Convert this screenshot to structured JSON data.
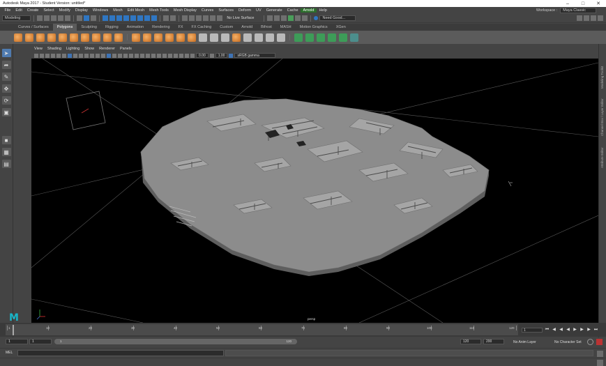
{
  "window": {
    "title": "Autodesk Maya 2017 - Student Version: untitled*"
  },
  "menubar": {
    "items": [
      "File",
      "Edit",
      "Create",
      "Select",
      "Modify",
      "Display",
      "Windows",
      "Mesh",
      "Edit Mesh",
      "Mesh Tools",
      "Mesh Display",
      "Curves",
      "Surfaces",
      "Deform",
      "UV",
      "Generate",
      "Cache",
      "Arnold",
      "Help"
    ],
    "highlighted": "Arnold",
    "workspace_label": "Workspace :",
    "workspace_value": "Maya Classic"
  },
  "statusline": {
    "mode": "Modeling",
    "live_surface": "No Live Surface",
    "user": "Need Good..."
  },
  "shelf": {
    "tabs": [
      "Curves / Surfaces",
      "Polygons",
      "Sculpting",
      "Rigging",
      "Animation",
      "Rendering",
      "FX",
      "FX Caching",
      "Custom",
      "Arnold",
      "Bifrost",
      "MASH",
      "Motion Graphics",
      "XGen"
    ],
    "active_tab": "Polygons"
  },
  "panel": {
    "menu": [
      "View",
      "Shading",
      "Lighting",
      "Show",
      "Renderer",
      "Panels"
    ],
    "exposure": "0.00",
    "gamma": "1.00",
    "color_space": "sRGB gamma",
    "camera": "persp"
  },
  "right_strip": {
    "labels": [
      "Modeling Toolkit",
      "Channel Box / Layer Editor",
      "Attribute Editor"
    ]
  },
  "timeline": {
    "ticks": [
      "1",
      "10",
      "20",
      "30",
      "40",
      "50",
      "60",
      "70",
      "80",
      "90",
      "100",
      "110",
      "120"
    ],
    "current_frame": "1"
  },
  "range": {
    "start_field": "1",
    "playback_start_field": "1",
    "bar_start": "1",
    "bar_end": "120",
    "playback_end": "120",
    "end": "200",
    "anim_layer": "No Anim Layer",
    "character_set": "No Character Set"
  },
  "cmdline": {
    "language": "MEL"
  },
  "viewport": {
    "background": "#000000",
    "mesh_color": "#8c8c8c",
    "grid_color": "#5a5a5a",
    "camera_label_color": "#dddddd",
    "logo_color": "#18b6c8"
  },
  "logo": {
    "text": "M"
  }
}
